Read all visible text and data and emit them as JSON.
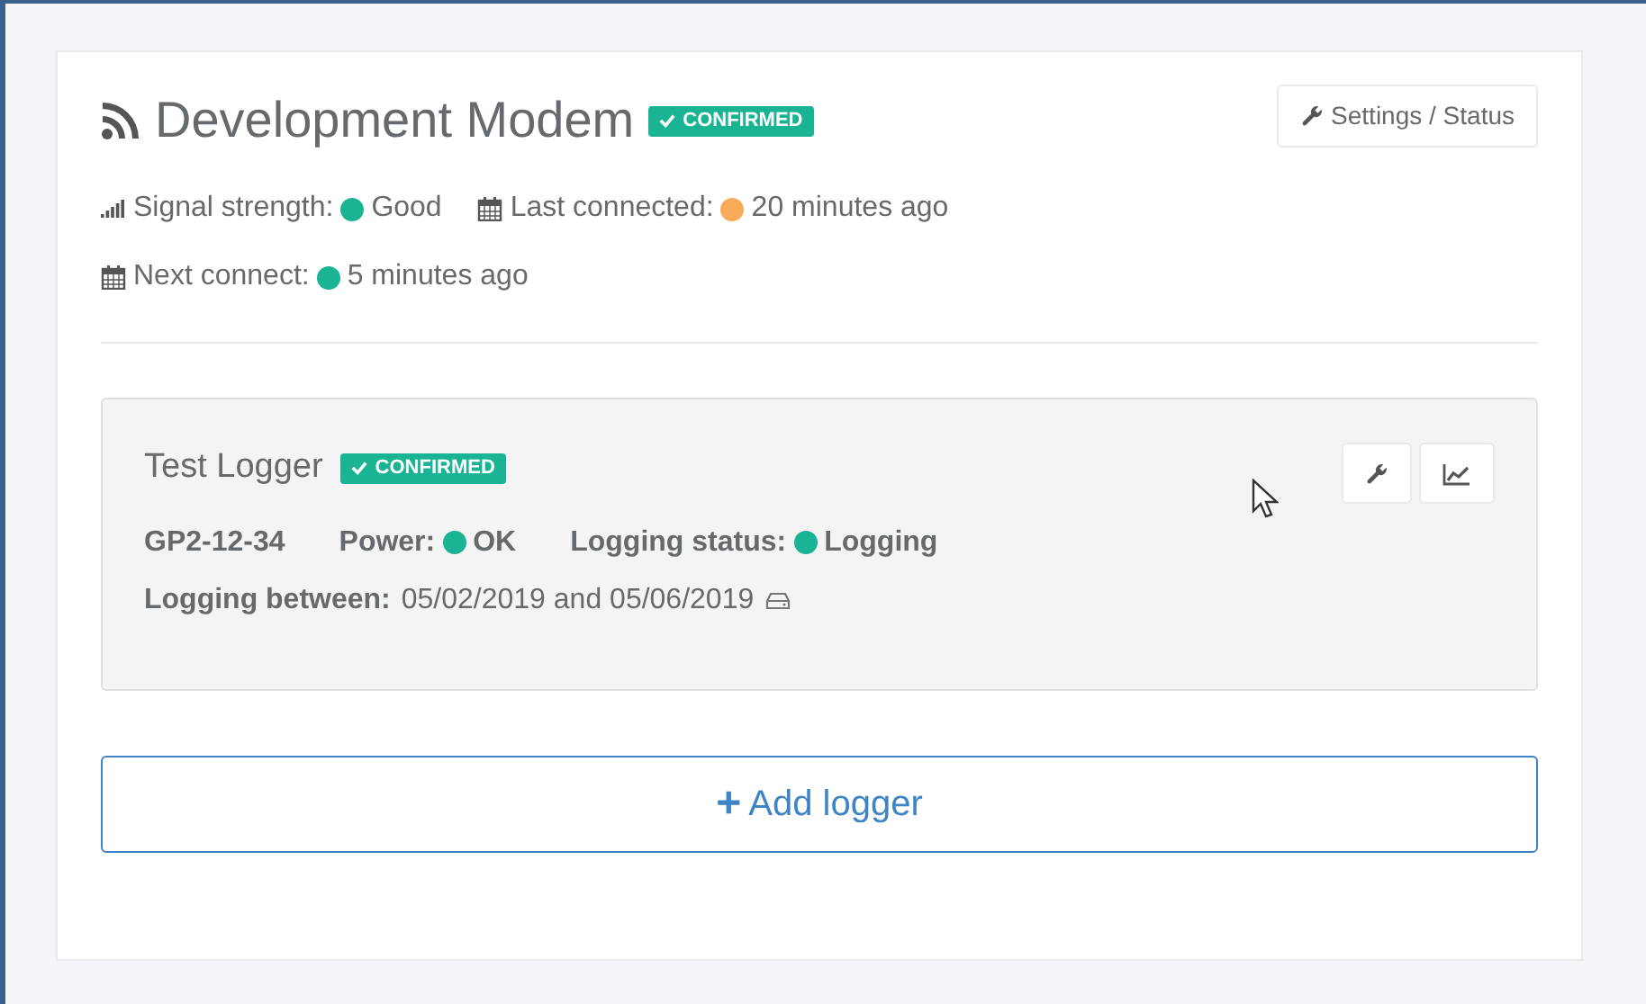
{
  "modem": {
    "title": "Development Modem",
    "badge": "CONFIRMED",
    "settings_button": "Settings / Status",
    "stats": [
      {
        "kind": "signal",
        "label": "Signal strength:",
        "color": "#1ab394",
        "value": "Good"
      },
      {
        "kind": "calendar",
        "label": "Last connected:",
        "color": "#f8ac59",
        "value": "20 minutes ago"
      },
      {
        "kind": "calendar",
        "label": "Next connect:",
        "color": "#1ab394",
        "value": "5 minutes ago"
      }
    ]
  },
  "loggers": [
    {
      "title": "Test Logger",
      "badge": "CONFIRMED",
      "serial": "GP2-12-34",
      "statuses": [
        {
          "label": "Power:",
          "color": "#1ab394",
          "value": "OK"
        },
        {
          "label": "Logging status:",
          "color": "#1ab394",
          "value": "Logging"
        }
      ],
      "period_label": "Logging between:",
      "period": "05/02/2019 and 05/06/2019"
    }
  ],
  "add_button": {
    "icon": "+",
    "label": "Add logger"
  }
}
